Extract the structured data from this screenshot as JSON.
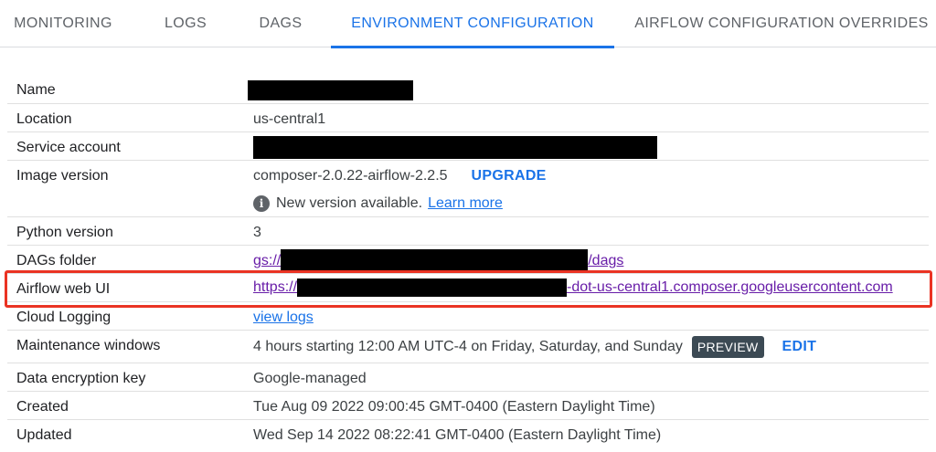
{
  "tabs": [
    {
      "label": "MONITORING"
    },
    {
      "label": "LOGS"
    },
    {
      "label": "DAGS"
    },
    {
      "label": "ENVIRONMENT CONFIGURATION"
    },
    {
      "label": "AIRFLOW CONFIGURATION OVERRIDES"
    }
  ],
  "active_tab": "ENVIRONMENT CONFIGURATION",
  "accent_color": "#1a73e8",
  "highlight_color": "#ea3323",
  "config": {
    "name": {
      "label": "Name"
    },
    "location": {
      "label": "Location",
      "value": "us-central1"
    },
    "service_account": {
      "label": "Service account"
    },
    "image_version": {
      "label": "Image version",
      "value": "composer-2.0.22-airflow-2.2.5",
      "action": "UPGRADE",
      "notice": "New version available.",
      "notice_link": "Learn more"
    },
    "python_version": {
      "label": "Python version",
      "value": "3"
    },
    "dags_folder": {
      "label": "DAGs folder",
      "prefix": "gs://",
      "suffix": "/dags"
    },
    "airflow_web_ui": {
      "label": "Airflow web UI",
      "prefix": "https://",
      "suffix": "-dot-us-central1.composer.googleusercontent.com"
    },
    "cloud_logging": {
      "label": "Cloud Logging",
      "link": "view logs"
    },
    "maintenance_windows": {
      "label": "Maintenance windows",
      "value": "4 hours starting 12:00 AM UTC-4 on Friday, Saturday, and Sunday",
      "chip": "PREVIEW",
      "action": "EDIT"
    },
    "data_encryption_key": {
      "label": "Data encryption key",
      "value": "Google-managed"
    },
    "created": {
      "label": "Created",
      "value": "Tue Aug 09 2022 09:00:45 GMT-0400 (Eastern Daylight Time)"
    },
    "updated": {
      "label": "Updated",
      "value": "Wed Sep 14 2022 08:22:41 GMT-0400 (Eastern Daylight Time)"
    }
  }
}
